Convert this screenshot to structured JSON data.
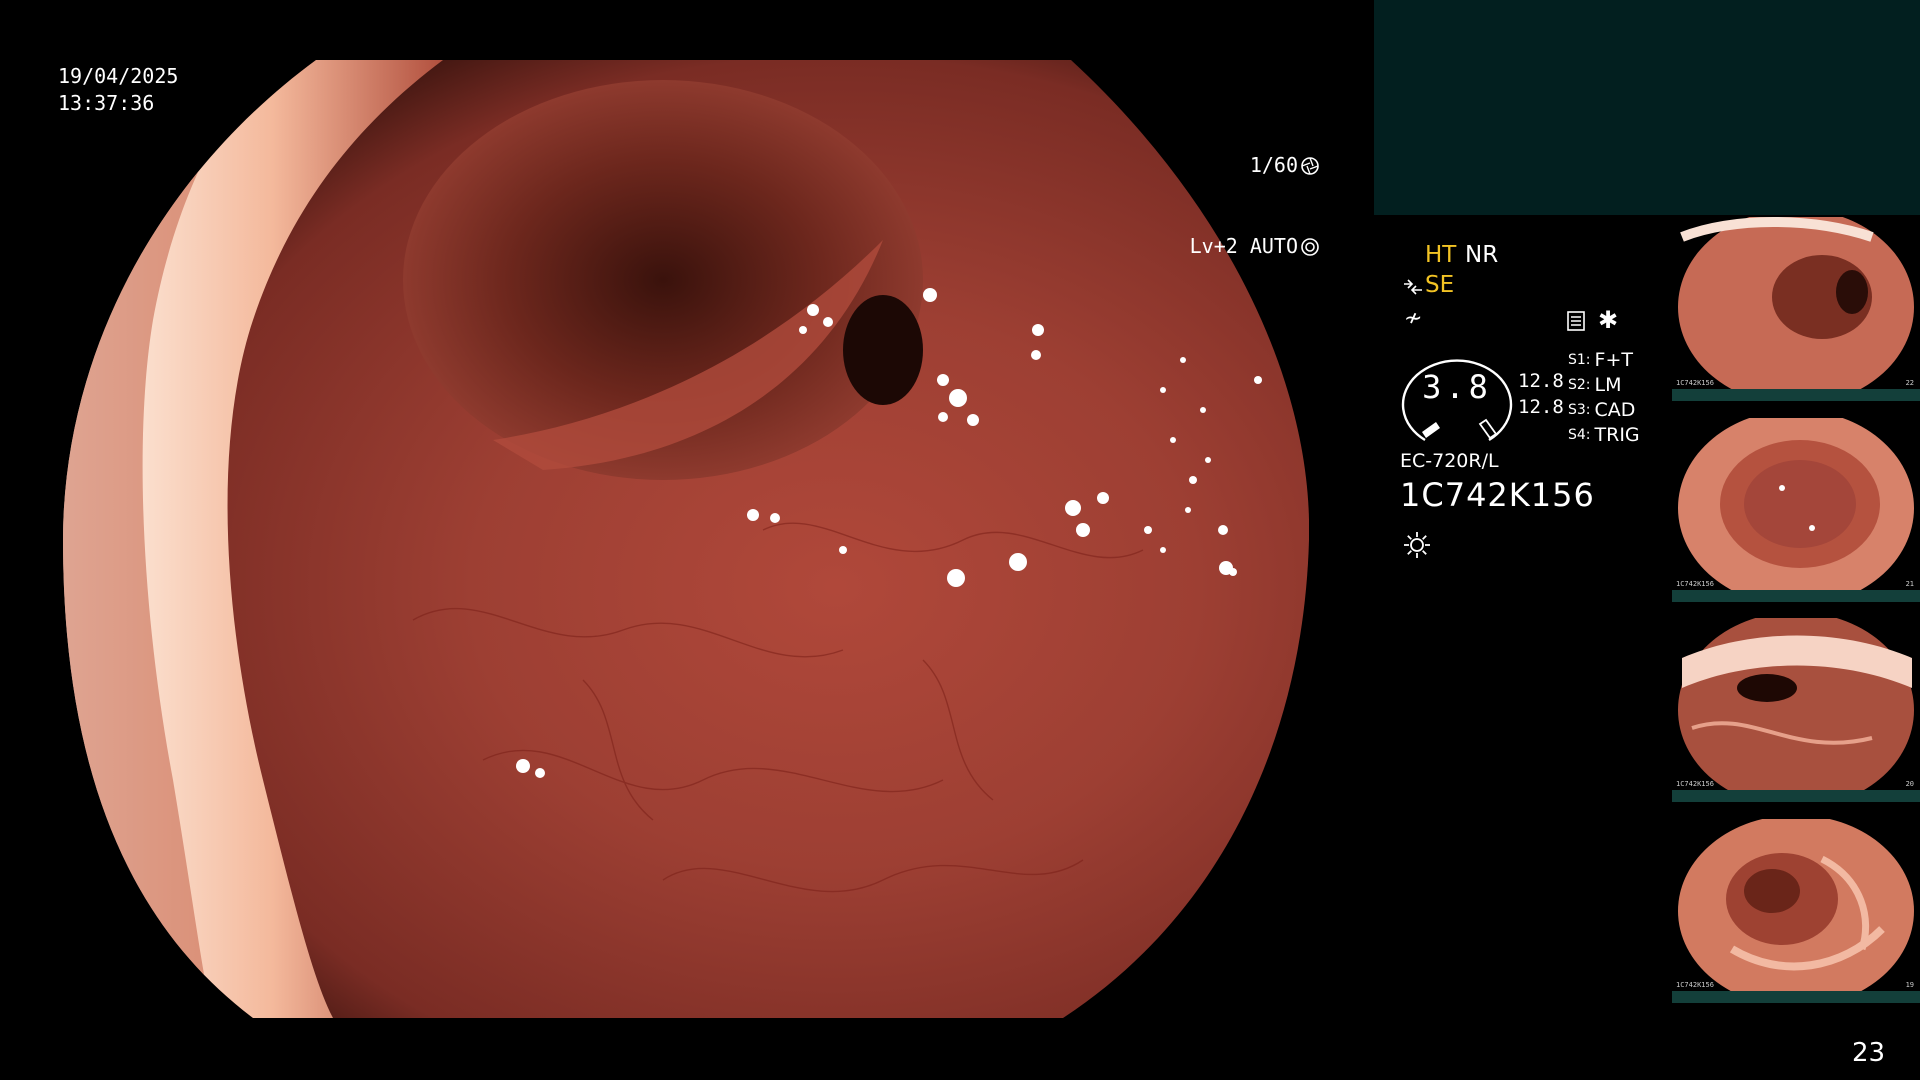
{
  "osd": {
    "date": "19/04/2025",
    "time": "13:37:36",
    "shutter": "1/60",
    "light_level": "Lv+2 AUTO"
  },
  "settings": {
    "ht": "HT",
    "nr": "NR",
    "se": "SE",
    "gauge_value": "3.8",
    "gain_1": "12.8",
    "gain_2": "12.8",
    "switches": [
      {
        "key": "S1:",
        "value": "F+T"
      },
      {
        "key": "S2:",
        "value": "LM"
      },
      {
        "key": "S3:",
        "value": "CAD"
      },
      {
        "key": "S4:",
        "value": "TRIG"
      }
    ],
    "scope_model": "EC-720R/L",
    "serial": "1C742K156",
    "accent_color": "#f2c324"
  },
  "thumbnails": [
    {
      "serial": "1C742K156",
      "number": "22"
    },
    {
      "serial": "1C742K156",
      "number": "21"
    },
    {
      "serial": "1C742K156",
      "number": "20"
    },
    {
      "serial": "1C742K156",
      "number": "19"
    }
  ],
  "page_number": "23",
  "icons": [
    "aperture-icon",
    "auto-iris-icon",
    "structure-enhance-icon",
    "filter-icon",
    "memory-icon",
    "star-icon",
    "lamp-icon"
  ]
}
